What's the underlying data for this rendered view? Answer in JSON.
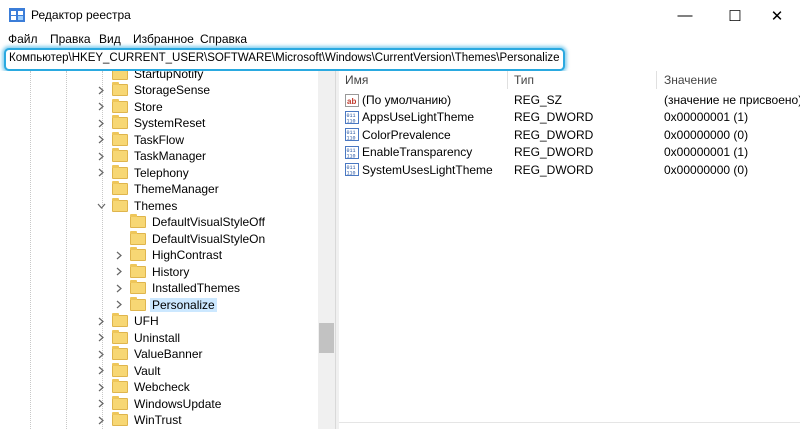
{
  "window": {
    "title": "Редактор реестра",
    "minimize_glyph": "—",
    "maximize_glyph": "☐",
    "close_glyph": "✕"
  },
  "menu": [
    "Файл",
    "Правка",
    "Вид",
    "Избранное",
    "Справка"
  ],
  "address": {
    "path": "Компьютер\\HKEY_CURRENT_USER\\SOFTWARE\\Microsoft\\Windows\\CurrentVersion\\Themes\\Personalize"
  },
  "tree": [
    {
      "label": "StartupNotify",
      "level": 0,
      "expander": "none"
    },
    {
      "label": "StorageSense",
      "level": 0,
      "expander": "collapsed"
    },
    {
      "label": "Store",
      "level": 0,
      "expander": "collapsed"
    },
    {
      "label": "SystemReset",
      "level": 0,
      "expander": "collapsed"
    },
    {
      "label": "TaskFlow",
      "level": 0,
      "expander": "collapsed"
    },
    {
      "label": "TaskManager",
      "level": 0,
      "expander": "collapsed"
    },
    {
      "label": "Telephony",
      "level": 0,
      "expander": "collapsed"
    },
    {
      "label": "ThemeManager",
      "level": 0,
      "expander": "none"
    },
    {
      "label": "Themes",
      "level": 0,
      "expander": "expanded"
    },
    {
      "label": "DefaultVisualStyleOff",
      "level": 1,
      "expander": "none"
    },
    {
      "label": "DefaultVisualStyleOn",
      "level": 1,
      "expander": "none"
    },
    {
      "label": "HighContrast",
      "level": 1,
      "expander": "collapsed"
    },
    {
      "label": "History",
      "level": 1,
      "expander": "collapsed"
    },
    {
      "label": "InstalledThemes",
      "level": 1,
      "expander": "collapsed"
    },
    {
      "label": "Personalize",
      "level": 1,
      "expander": "collapsed",
      "selected": true
    },
    {
      "label": "UFH",
      "level": 0,
      "expander": "collapsed"
    },
    {
      "label": "Uninstall",
      "level": 0,
      "expander": "collapsed"
    },
    {
      "label": "ValueBanner",
      "level": 0,
      "expander": "collapsed"
    },
    {
      "label": "Vault",
      "level": 0,
      "expander": "collapsed"
    },
    {
      "label": "Webcheck",
      "level": 0,
      "expander": "collapsed"
    },
    {
      "label": "WindowsUpdate",
      "level": 0,
      "expander": "collapsed"
    },
    {
      "label": "WinTrust",
      "level": 0,
      "expander": "collapsed"
    }
  ],
  "values_table": {
    "columns": [
      "Имя",
      "Тип",
      "Значение"
    ],
    "rows": [
      {
        "name": "(По умолчанию)",
        "type": "REG_SZ",
        "data": "(значение не присвоено)",
        "icon": "string-value-icon"
      },
      {
        "name": "AppsUseLightTheme",
        "type": "REG_DWORD",
        "data": "0x00000001 (1)",
        "icon": "binary-value-icon"
      },
      {
        "name": "ColorPrevalence",
        "type": "REG_DWORD",
        "data": "0x00000000 (0)",
        "icon": "binary-value-icon"
      },
      {
        "name": "EnableTransparency",
        "type": "REG_DWORD",
        "data": "0x00000001 (1)",
        "icon": "binary-value-icon"
      },
      {
        "name": "SystemUsesLightTheme",
        "type": "REG_DWORD",
        "data": "0x00000000 (0)",
        "icon": "binary-value-icon"
      }
    ]
  },
  "colors": {
    "address_highlight": "#2aa9e0",
    "selection": "#cce8ff",
    "folder": "#f7d774"
  }
}
